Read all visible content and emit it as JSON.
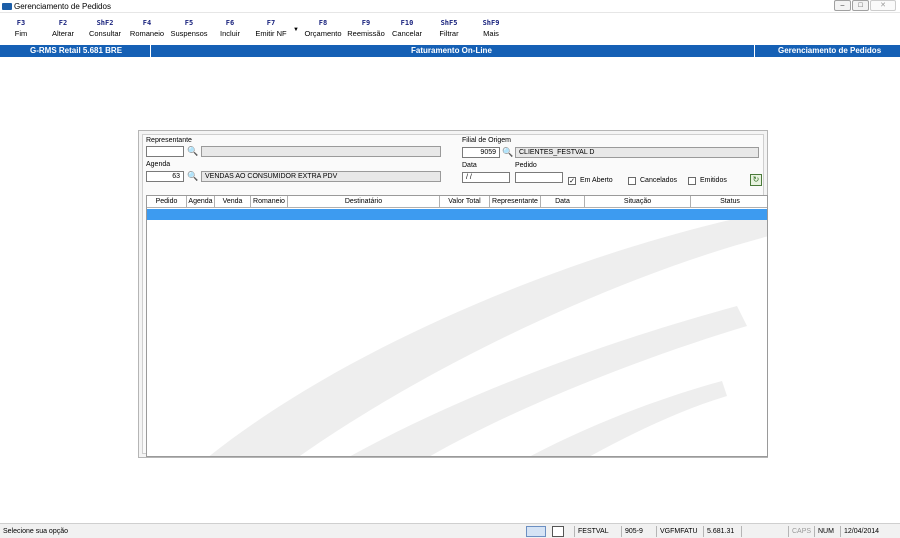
{
  "window": {
    "title": "Gerenciamento de Pedidos",
    "buttons": [
      "minimize",
      "maximize",
      "close"
    ]
  },
  "toolbar": [
    {
      "key": "F3",
      "label": "Fim"
    },
    {
      "key": "F2",
      "label": "Alterar"
    },
    {
      "key": "ShF2",
      "label": "Consultar"
    },
    {
      "key": "F4",
      "label": "Romaneio"
    },
    {
      "key": "F5",
      "label": "Suspensos"
    },
    {
      "key": "F6",
      "label": "Incluir"
    },
    {
      "key": "F7",
      "label": "Emitir NF"
    },
    {
      "key": "F8",
      "label": "Orçamento"
    },
    {
      "key": "F9",
      "label": "Reemissão"
    },
    {
      "key": "F10",
      "label": "Cancelar"
    },
    {
      "key": "ShF5",
      "label": "Filtrar"
    },
    {
      "key": "ShF9",
      "label": "Mais"
    }
  ],
  "bluebar": {
    "left": "G-RMS Retail 5.681 BRE",
    "center": "Faturamento On-Line",
    "right": "Gerenciamento de Pedidos"
  },
  "form": {
    "representante_label": "Representante",
    "representante_code": "",
    "representante_name": "",
    "agenda_label": "Agenda",
    "agenda_code": "63",
    "agenda_name": "VENDAS AO CONSUMIDOR EXTRA PDV",
    "filial_label": "Filial de Origem",
    "filial_code": "9059",
    "filial_name": "CLIENTES_FESTVAL D",
    "data_label": "Data",
    "data_value": "/ /",
    "pedido_label": "Pedido",
    "pedido_value": "",
    "em_aberto_label": "Em Aberto",
    "em_aberto_checked": true,
    "cancelados_label": "Cancelados",
    "cancelados_checked": false,
    "emitidos_label": "Emitidos",
    "emitidos_checked": false
  },
  "grid": {
    "columns": [
      "Pedido",
      "Agenda",
      "Venda",
      "Romaneio",
      "Destinatário",
      "Valor Total",
      "Representante",
      "Data",
      "Situação",
      "Status"
    ],
    "rows": []
  },
  "statusbar": {
    "message": "Selecione sua opção",
    "cells": [
      "FESTVAL",
      "905-9",
      "VGFMFATU",
      "5.681.31",
      "",
      "CAPS",
      "NUM",
      "12/04/2014"
    ]
  },
  "icons": {
    "binoculars": "binoculars-icon",
    "refresh": "refresh-icon",
    "keyboard": "keyboard-icon",
    "document": "document-icon"
  }
}
